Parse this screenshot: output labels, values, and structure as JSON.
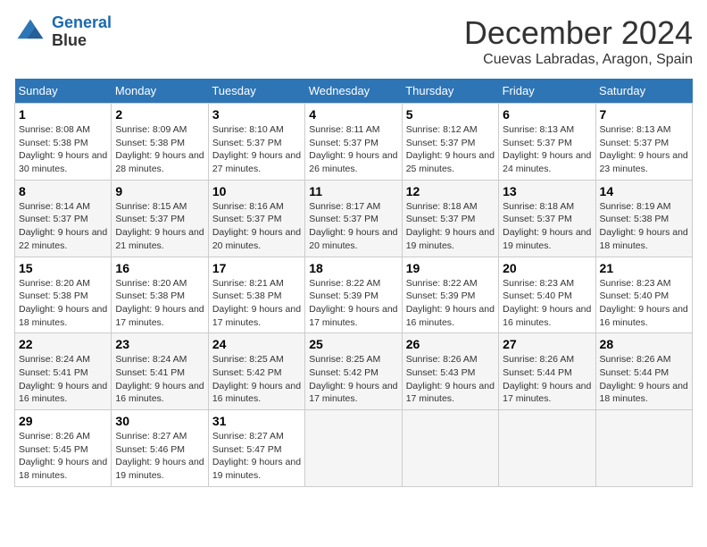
{
  "header": {
    "logo_line1": "General",
    "logo_line2": "Blue",
    "month": "December 2024",
    "location": "Cuevas Labradas, Aragon, Spain"
  },
  "weekdays": [
    "Sunday",
    "Monday",
    "Tuesday",
    "Wednesday",
    "Thursday",
    "Friday",
    "Saturday"
  ],
  "days": [
    {
      "date": "",
      "info": ""
    },
    {
      "date": "",
      "info": ""
    },
    {
      "date": "",
      "info": ""
    },
    {
      "date": "",
      "info": ""
    },
    {
      "date": "",
      "info": ""
    },
    {
      "date": "",
      "info": ""
    },
    {
      "date": "1",
      "sunrise": "Sunrise: 8:08 AM",
      "sunset": "Sunset: 5:38 PM",
      "daylight": "Daylight: 9 hours and 30 minutes."
    },
    {
      "date": "2",
      "sunrise": "Sunrise: 8:09 AM",
      "sunset": "Sunset: 5:38 PM",
      "daylight": "Daylight: 9 hours and 28 minutes."
    },
    {
      "date": "3",
      "sunrise": "Sunrise: 8:10 AM",
      "sunset": "Sunset: 5:37 PM",
      "daylight": "Daylight: 9 hours and 27 minutes."
    },
    {
      "date": "4",
      "sunrise": "Sunrise: 8:11 AM",
      "sunset": "Sunset: 5:37 PM",
      "daylight": "Daylight: 9 hours and 26 minutes."
    },
    {
      "date": "5",
      "sunrise": "Sunrise: 8:12 AM",
      "sunset": "Sunset: 5:37 PM",
      "daylight": "Daylight: 9 hours and 25 minutes."
    },
    {
      "date": "6",
      "sunrise": "Sunrise: 8:13 AM",
      "sunset": "Sunset: 5:37 PM",
      "daylight": "Daylight: 9 hours and 24 minutes."
    },
    {
      "date": "7",
      "sunrise": "Sunrise: 8:13 AM",
      "sunset": "Sunset: 5:37 PM",
      "daylight": "Daylight: 9 hours and 23 minutes."
    },
    {
      "date": "8",
      "sunrise": "Sunrise: 8:14 AM",
      "sunset": "Sunset: 5:37 PM",
      "daylight": "Daylight: 9 hours and 22 minutes."
    },
    {
      "date": "9",
      "sunrise": "Sunrise: 8:15 AM",
      "sunset": "Sunset: 5:37 PM",
      "daylight": "Daylight: 9 hours and 21 minutes."
    },
    {
      "date": "10",
      "sunrise": "Sunrise: 8:16 AM",
      "sunset": "Sunset: 5:37 PM",
      "daylight": "Daylight: 9 hours and 20 minutes."
    },
    {
      "date": "11",
      "sunrise": "Sunrise: 8:17 AM",
      "sunset": "Sunset: 5:37 PM",
      "daylight": "Daylight: 9 hours and 20 minutes."
    },
    {
      "date": "12",
      "sunrise": "Sunrise: 8:18 AM",
      "sunset": "Sunset: 5:37 PM",
      "daylight": "Daylight: 9 hours and 19 minutes."
    },
    {
      "date": "13",
      "sunrise": "Sunrise: 8:18 AM",
      "sunset": "Sunset: 5:37 PM",
      "daylight": "Daylight: 9 hours and 19 minutes."
    },
    {
      "date": "14",
      "sunrise": "Sunrise: 8:19 AM",
      "sunset": "Sunset: 5:38 PM",
      "daylight": "Daylight: 9 hours and 18 minutes."
    },
    {
      "date": "15",
      "sunrise": "Sunrise: 8:20 AM",
      "sunset": "Sunset: 5:38 PM",
      "daylight": "Daylight: 9 hours and 18 minutes."
    },
    {
      "date": "16",
      "sunrise": "Sunrise: 8:20 AM",
      "sunset": "Sunset: 5:38 PM",
      "daylight": "Daylight: 9 hours and 17 minutes."
    },
    {
      "date": "17",
      "sunrise": "Sunrise: 8:21 AM",
      "sunset": "Sunset: 5:38 PM",
      "daylight": "Daylight: 9 hours and 17 minutes."
    },
    {
      "date": "18",
      "sunrise": "Sunrise: 8:22 AM",
      "sunset": "Sunset: 5:39 PM",
      "daylight": "Daylight: 9 hours and 17 minutes."
    },
    {
      "date": "19",
      "sunrise": "Sunrise: 8:22 AM",
      "sunset": "Sunset: 5:39 PM",
      "daylight": "Daylight: 9 hours and 16 minutes."
    },
    {
      "date": "20",
      "sunrise": "Sunrise: 8:23 AM",
      "sunset": "Sunset: 5:40 PM",
      "daylight": "Daylight: 9 hours and 16 minutes."
    },
    {
      "date": "21",
      "sunrise": "Sunrise: 8:23 AM",
      "sunset": "Sunset: 5:40 PM",
      "daylight": "Daylight: 9 hours and 16 minutes."
    },
    {
      "date": "22",
      "sunrise": "Sunrise: 8:24 AM",
      "sunset": "Sunset: 5:41 PM",
      "daylight": "Daylight: 9 hours and 16 minutes."
    },
    {
      "date": "23",
      "sunrise": "Sunrise: 8:24 AM",
      "sunset": "Sunset: 5:41 PM",
      "daylight": "Daylight: 9 hours and 16 minutes."
    },
    {
      "date": "24",
      "sunrise": "Sunrise: 8:25 AM",
      "sunset": "Sunset: 5:42 PM",
      "daylight": "Daylight: 9 hours and 16 minutes."
    },
    {
      "date": "25",
      "sunrise": "Sunrise: 8:25 AM",
      "sunset": "Sunset: 5:42 PM",
      "daylight": "Daylight: 9 hours and 17 minutes."
    },
    {
      "date": "26",
      "sunrise": "Sunrise: 8:26 AM",
      "sunset": "Sunset: 5:43 PM",
      "daylight": "Daylight: 9 hours and 17 minutes."
    },
    {
      "date": "27",
      "sunrise": "Sunrise: 8:26 AM",
      "sunset": "Sunset: 5:44 PM",
      "daylight": "Daylight: 9 hours and 17 minutes."
    },
    {
      "date": "28",
      "sunrise": "Sunrise: 8:26 AM",
      "sunset": "Sunset: 5:44 PM",
      "daylight": "Daylight: 9 hours and 18 minutes."
    },
    {
      "date": "29",
      "sunrise": "Sunrise: 8:26 AM",
      "sunset": "Sunset: 5:45 PM",
      "daylight": "Daylight: 9 hours and 18 minutes."
    },
    {
      "date": "30",
      "sunrise": "Sunrise: 8:27 AM",
      "sunset": "Sunset: 5:46 PM",
      "daylight": "Daylight: 9 hours and 19 minutes."
    },
    {
      "date": "31",
      "sunrise": "Sunrise: 8:27 AM",
      "sunset": "Sunset: 5:47 PM",
      "daylight": "Daylight: 9 hours and 19 minutes."
    },
    {
      "date": "",
      "info": ""
    },
    {
      "date": "",
      "info": ""
    },
    {
      "date": "",
      "info": ""
    },
    {
      "date": "",
      "info": ""
    },
    {
      "date": "",
      "info": ""
    }
  ]
}
